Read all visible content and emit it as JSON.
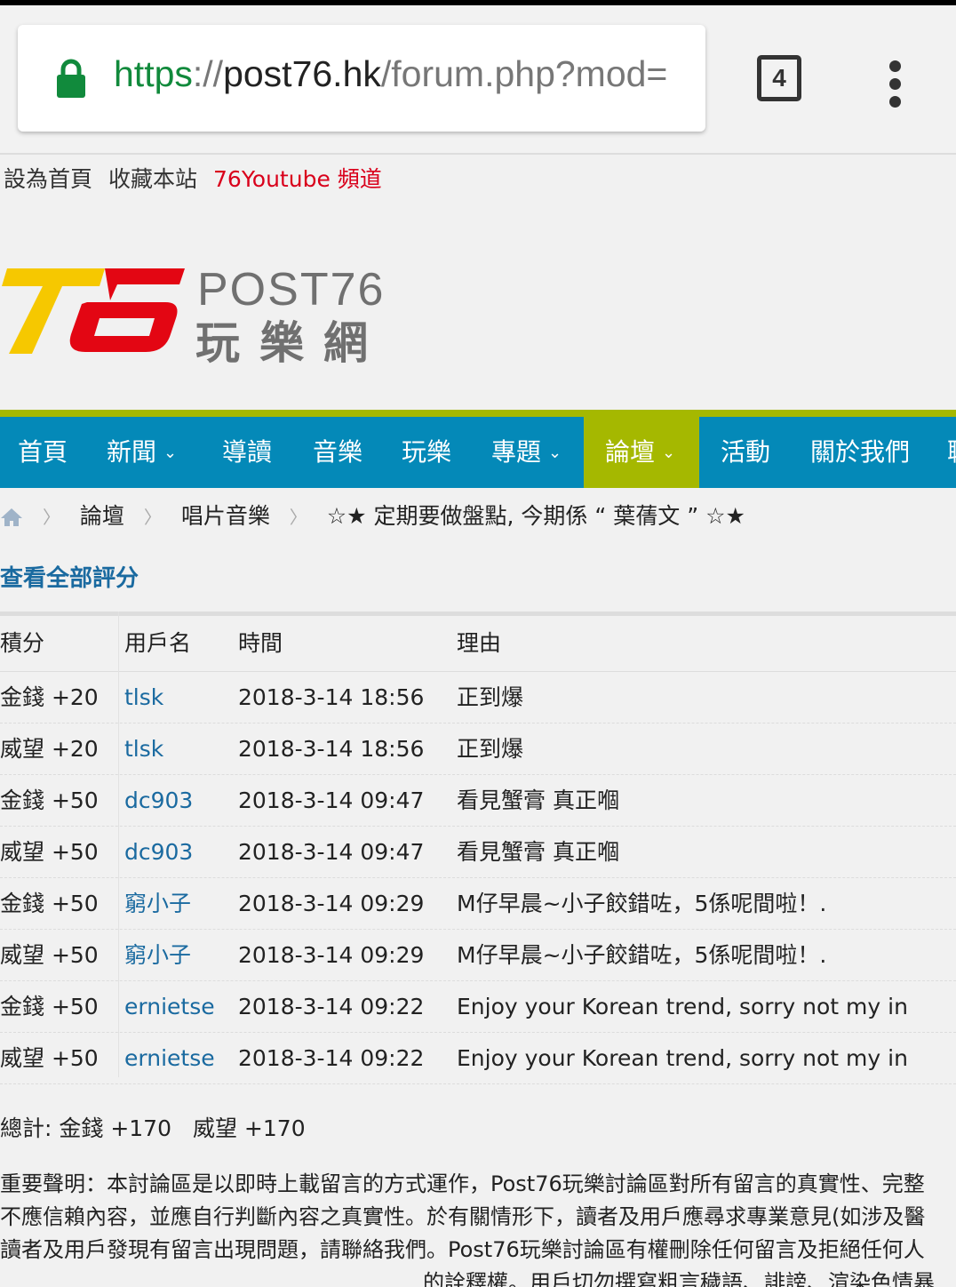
{
  "browser": {
    "url_scheme": "https",
    "url_sep": "://",
    "url_host": "post76.hk",
    "url_path": "/forum.php?mod=",
    "tab_count": "4"
  },
  "toplinks": {
    "home": "設為首頁",
    "bookmark": "收藏本站",
    "youtube": "76Youtube 頻道"
  },
  "brand": {
    "en": "POST76",
    "zh": "玩樂網",
    "colors": {
      "yellow": "#f6c800",
      "red": "#e30613"
    }
  },
  "nav": {
    "items": [
      {
        "label": "首頁",
        "has_dropdown": false
      },
      {
        "label": "新聞",
        "has_dropdown": true
      },
      {
        "label": "導讀",
        "has_dropdown": false
      },
      {
        "label": "音樂",
        "has_dropdown": false
      },
      {
        "label": "玩樂",
        "has_dropdown": false
      },
      {
        "label": "專題",
        "has_dropdown": true
      },
      {
        "label": "論壇",
        "has_dropdown": true,
        "active": true
      },
      {
        "label": "活動",
        "has_dropdown": false
      },
      {
        "label": "關於我們",
        "has_dropdown": false
      },
      {
        "label": "聯",
        "has_dropdown": false
      }
    ],
    "chevron": "⌄"
  },
  "breadcrumb": {
    "items": [
      "論壇",
      "唱片音樂",
      "☆★ 定期要做盤點, 今期係 “ 葉蒨文 ” ☆★"
    ],
    "separator": "〉"
  },
  "ratings": {
    "title": "查看全部評分",
    "headers": [
      "積分",
      "用戶名",
      "時間",
      "理由"
    ],
    "rows": [
      [
        "金錢 +20",
        "tlsk",
        "2018-3-14 18:56",
        "正到爆"
      ],
      [
        "威望 +20",
        "tlsk",
        "2018-3-14 18:56",
        "正到爆"
      ],
      [
        "金錢 +50",
        "dc903",
        "2018-3-14 09:47",
        "看見蟹膏 真正嗰"
      ],
      [
        "威望 +50",
        "dc903",
        "2018-3-14 09:47",
        "看見蟹膏 真正嗰"
      ],
      [
        "金錢 +50",
        "窮小子",
        "2018-3-14 09:29",
        "M仔早晨~小子餃錯咗，5係呢間啦！."
      ],
      [
        "威望 +50",
        "窮小子",
        "2018-3-14 09:29",
        "M仔早晨~小子餃錯咗，5係呢間啦！."
      ],
      [
        "金錢 +50",
        "ernietse",
        "2018-3-14 09:22",
        "Enjoy your Korean trend, sorry not my in"
      ],
      [
        "威望 +50",
        "ernietse",
        "2018-3-14 09:22",
        "Enjoy your Korean trend, sorry not my in"
      ]
    ],
    "total_label": "總計: 金錢 +170",
    "total_weiwang": "威望 +170"
  },
  "disclaimer": {
    "line1": " 重要聲明：本討論區是以即時上載留言的方式運作，Post76玩樂討論區對所有留言的真實性、完整",
    "line2": "不應信賴內容，並應自行判斷內容之真實性。於有關情形下，讀者及用戶應尋求專業意見(如涉及醫",
    "line3": " 讀者及用戶發現有留言出現問題，請聯絡我們。Post76玩樂討論區有權刪除任何留言及拒絕任何人",
    "line4": "的詮釋權。用戶切勿撰寫粗言穢語、誹謗、渲染色情暴"
  }
}
